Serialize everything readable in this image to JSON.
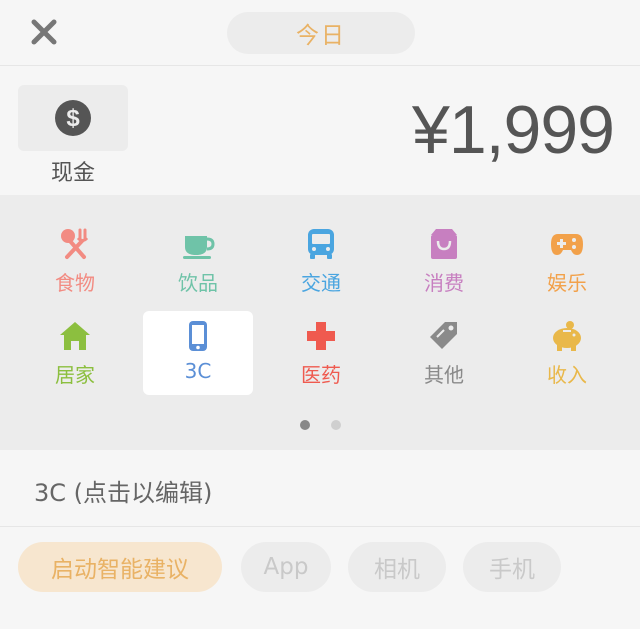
{
  "header": {
    "date_label": "今日"
  },
  "account": {
    "label": "现金",
    "icon": "dollar-coin-icon"
  },
  "amount": {
    "value": "¥1,999"
  },
  "categories": [
    {
      "label": "食物",
      "icon": "fork-knife-icon",
      "color": "#f28b82"
    },
    {
      "label": "饮品",
      "icon": "coffee-cup-icon",
      "color": "#6fc3a8"
    },
    {
      "label": "交通",
      "icon": "bus-icon",
      "color": "#4aa5e0"
    },
    {
      "label": "消费",
      "icon": "shopping-bag-icon",
      "color": "#c77fc0"
    },
    {
      "label": "娱乐",
      "icon": "gamepad-icon",
      "color": "#f2a14a"
    },
    {
      "label": "居家",
      "icon": "home-icon",
      "color": "#8cbf3f"
    },
    {
      "label": "3C",
      "icon": "phone-icon",
      "color": "#5b8fd6",
      "selected": true
    },
    {
      "label": "医药",
      "icon": "medical-cross-icon",
      "color": "#ef5a4f"
    },
    {
      "label": "其他",
      "icon": "tag-icon",
      "color": "#8a8a8a"
    },
    {
      "label": "收入",
      "icon": "piggy-bank-icon",
      "color": "#e9b84a"
    }
  ],
  "pager": {
    "active_index": 0,
    "count": 2
  },
  "note": {
    "text": "3C (点击以编辑)"
  },
  "suggestions": {
    "primary_label": "启动智能建议",
    "tags": [
      "App",
      "相机",
      "手机"
    ]
  }
}
